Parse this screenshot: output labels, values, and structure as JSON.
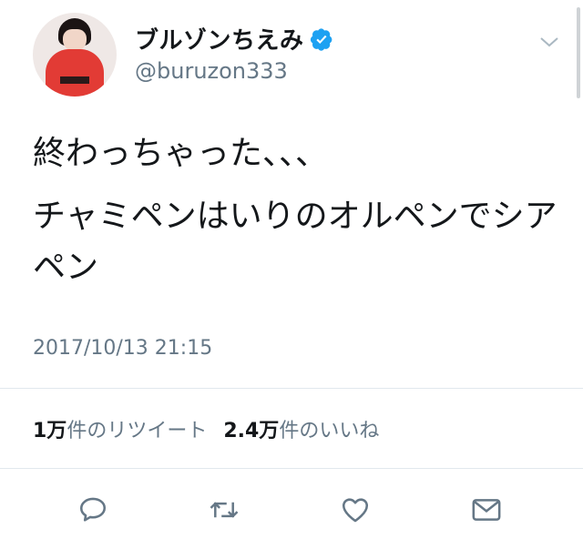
{
  "user": {
    "display_name": "ブルゾンちえみ",
    "handle": "@buruzon333",
    "verified": true
  },
  "tweet": {
    "line1": "終わっちゃった、、、",
    "line2": "チャミペンはいりのオルペンでシアペン",
    "timestamp": "2017/10/13 21:15"
  },
  "stats": {
    "retweets_count": "1万",
    "retweets_label": "件のリツイート",
    "likes_count": "2.4万",
    "likes_label": "件のいいね"
  },
  "icons": {
    "verified": "verified-badge-icon",
    "more": "chevron-down-icon",
    "reply": "reply-icon",
    "retweet": "retweet-icon",
    "like": "heart-icon",
    "message": "envelope-icon"
  },
  "colors": {
    "verified_blue": "#1da1f2",
    "secondary_text": "#657786",
    "icon_gray": "#657786"
  }
}
